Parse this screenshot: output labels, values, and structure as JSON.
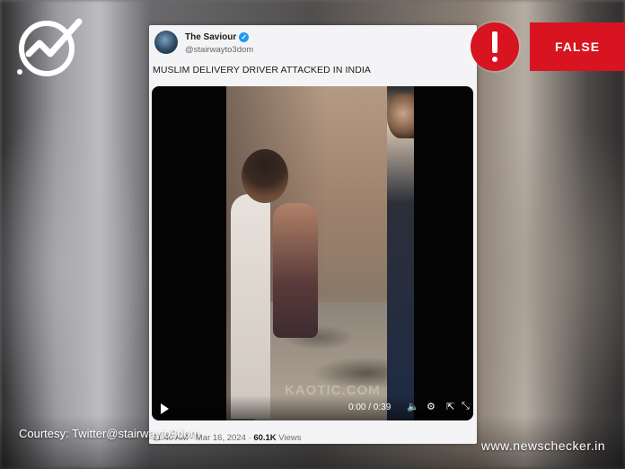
{
  "tweet": {
    "user_name": "The Saviour",
    "user_handle": "@stairwayto3dom",
    "text": "MUSLIM DELIVERY DRIVER ATTACKED IN INDIA",
    "meta_prefix": "11:40 AM · Mar 16, 2024 · ",
    "views_count": "60.1K",
    "views_label": " Views"
  },
  "video": {
    "time": "0:00 / 0:39",
    "watermark": "KAOTIC.COM"
  },
  "badge": {
    "verdict": "FALSE"
  },
  "footer": {
    "courtesy": "Courtesy: Twitter@stairwayto3dom",
    "site": "www.newschecker.in"
  },
  "colors": {
    "verdict_red": "#d7141f",
    "verified_blue": "#1d9bf0"
  },
  "icons": [
    "newschecker-logo-icon",
    "verified-badge-icon",
    "play-icon",
    "volume-icon",
    "settings-icon",
    "share-icon",
    "fullscreen-icon",
    "alert-icon"
  ]
}
